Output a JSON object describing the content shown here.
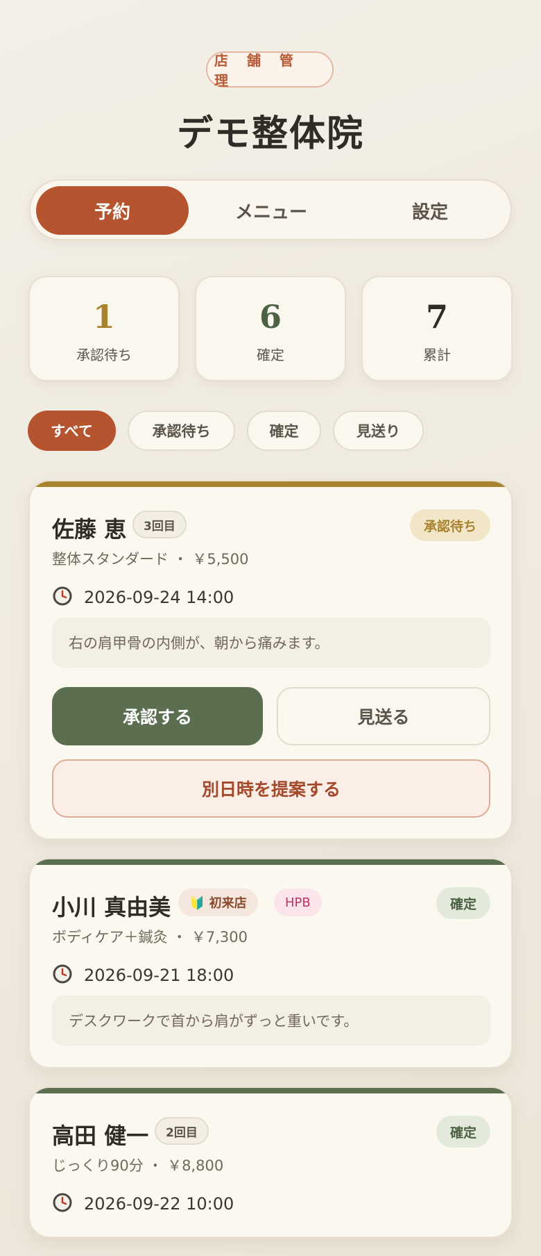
{
  "header": {
    "badge": "店 舗 管 理",
    "title": "デモ整体院"
  },
  "tabs": [
    {
      "label": "予約",
      "active": true
    },
    {
      "label": "メニュー",
      "active": false
    },
    {
      "label": "設定",
      "active": false
    }
  ],
  "stats": [
    {
      "value": "1",
      "label": "承認待ち",
      "color": "#a8832d"
    },
    {
      "value": "6",
      "label": "確定",
      "color": "#4d6143"
    },
    {
      "value": "7",
      "label": "累計",
      "color": "#2f2b26"
    }
  ],
  "filters": [
    {
      "label": "すべて",
      "active": true
    },
    {
      "label": "承認待ち",
      "active": false
    },
    {
      "label": "確定",
      "active": false
    },
    {
      "label": "見送り",
      "active": false
    }
  ],
  "reservations": [
    {
      "name": "佐藤 恵",
      "visit": "3回目",
      "status": "承認待ち",
      "service": "整体スタンダード ・ ￥5,500",
      "datetime": "2026-09-24 14:00",
      "note": "右の肩甲骨の内側が、朝から痛みます。",
      "actions": {
        "approve": "承認する",
        "decline": "見送る",
        "propose": "別日時を提案する"
      }
    },
    {
      "name": "小川 真由美",
      "tags": [
        "🔰 初来店",
        "HPB"
      ],
      "status": "確定",
      "service": "ボディケア＋鍼灸 ・ ￥7,300",
      "datetime": "2026-09-21 18:00",
      "note": "デスクワークで首から肩がずっと重いです。"
    },
    {
      "name": "高田 健一",
      "visit": "2回目",
      "status": "確定",
      "service": "じっくり90分 ・ ￥8,800",
      "datetime": "2026-09-22 10:00"
    }
  ],
  "colors": {
    "accent": "#b5542e",
    "pending": "#a8832d",
    "confirmed": "#5b6e4f"
  }
}
